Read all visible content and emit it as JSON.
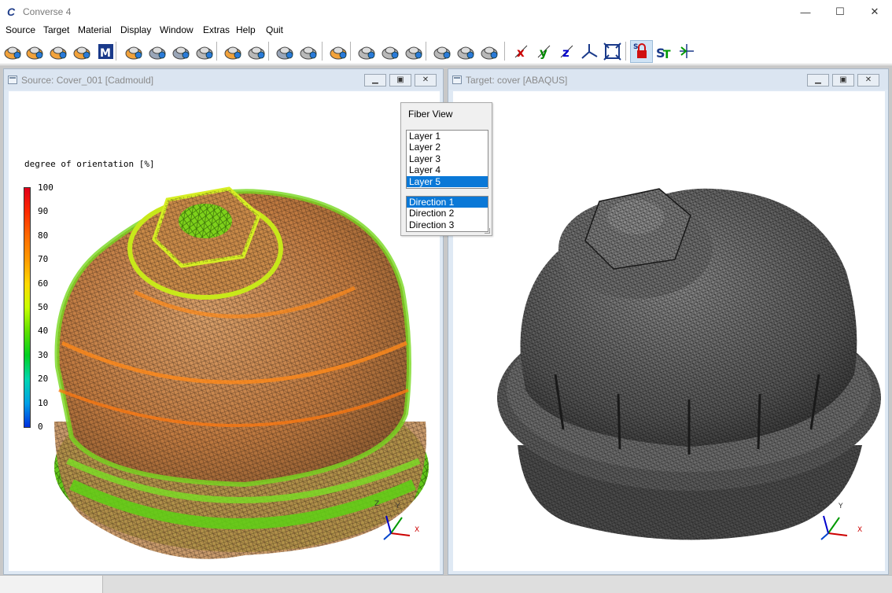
{
  "app": {
    "title": "Converse 4"
  },
  "window_controls": {
    "minimize": "—",
    "maximize": "☐",
    "close": "✕"
  },
  "menu": [
    "Source",
    "Target",
    "Material",
    "Display",
    "Window",
    "Extras",
    "Help",
    "Quit"
  ],
  "toolbar": {
    "icons": [
      "open-source-icon",
      "source-mesh-icon",
      "source-surface-icon",
      "source-view-icon",
      "material-database-icon",
      "open-target-icon",
      "target-mesh-icon",
      "target-surface-icon",
      "target-view-icon",
      "point-source-icon",
      "point-view-icon",
      "map-target-icon",
      "map-view-icon",
      "transfer-icon",
      "hide-source-icon",
      "hide-surface-icon",
      "hide-view-icon",
      "move-source-icon",
      "move-mesh-icon",
      "move-view-icon",
      "rotate-x-icon",
      "rotate-y-icon",
      "rotate-z-icon",
      "axes-icon",
      "fit-view-icon",
      "lock-icon",
      "set-text-icon",
      "align-icon"
    ]
  },
  "source_window": {
    "title": "Source: Cover_001 [Cadmould]"
  },
  "target_window": {
    "title": "Target: cover [ABAQUS]"
  },
  "legend": {
    "title": "degree of orientation [%]",
    "ticks": [
      "100",
      "90",
      "80",
      "70",
      "60",
      "50",
      "40",
      "30",
      "20",
      "10",
      "0"
    ],
    "colors": [
      "#e0001a",
      "#ff2a00",
      "#ff6a00",
      "#ff9a00",
      "#ffd800",
      "#c8ff00",
      "#5ee000",
      "#00d020",
      "#00d6b0",
      "#00a0e6",
      "#0030e0"
    ]
  },
  "axes": {
    "x": "X",
    "y": "Y",
    "z": "Z"
  },
  "fiber_view": {
    "title": "Fiber View",
    "layers": [
      "Layer 1",
      "Layer 2",
      "Layer 3",
      "Layer 4",
      "Layer 5"
    ],
    "selected_layer": "Layer 5",
    "directions": [
      "Direction 1",
      "Direction 2",
      "Direction 3"
    ],
    "selected_direction": "Direction 1"
  }
}
